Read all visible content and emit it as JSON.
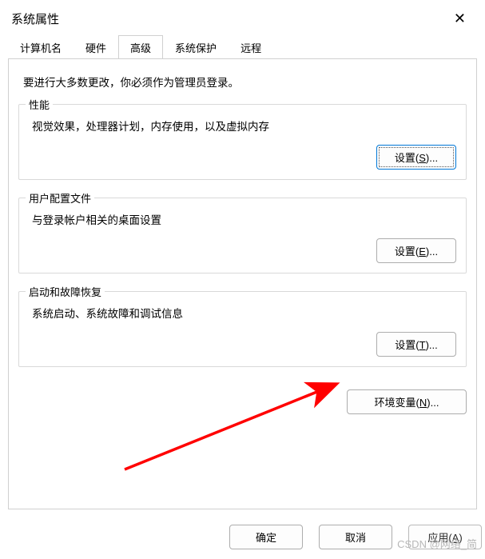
{
  "window": {
    "title": "系统属性",
    "close": "✕"
  },
  "tabs": {
    "items": [
      {
        "label": "计算机名"
      },
      {
        "label": "硬件"
      },
      {
        "label": "高级"
      },
      {
        "label": "系统保护"
      },
      {
        "label": "远程"
      }
    ],
    "active_index": 2
  },
  "panel": {
    "intro": "要进行大多数更改，你必须作为管理员登录。"
  },
  "groups": {
    "performance": {
      "legend": "性能",
      "desc": "视觉效果，处理器计划，内存使用，以及虚拟内存",
      "button_pre": "设置(",
      "button_key": "S",
      "button_post": ")..."
    },
    "profiles": {
      "legend": "用户配置文件",
      "desc": "与登录帐户相关的桌面设置",
      "button_pre": "设置(",
      "button_key": "E",
      "button_post": ")..."
    },
    "startup": {
      "legend": "启动和故障恢复",
      "desc": "系统启动、系统故障和调试信息",
      "button_pre": "设置(",
      "button_key": "T",
      "button_post": ")..."
    }
  },
  "env": {
    "button_pre": "环境变量(",
    "button_key": "N",
    "button_post": ")..."
  },
  "footer": {
    "ok": "确定",
    "cancel": "取消",
    "apply_pre": "应用(",
    "apply_key": "A",
    "apply_post": ")"
  },
  "watermark": "CSDN @网络_简"
}
